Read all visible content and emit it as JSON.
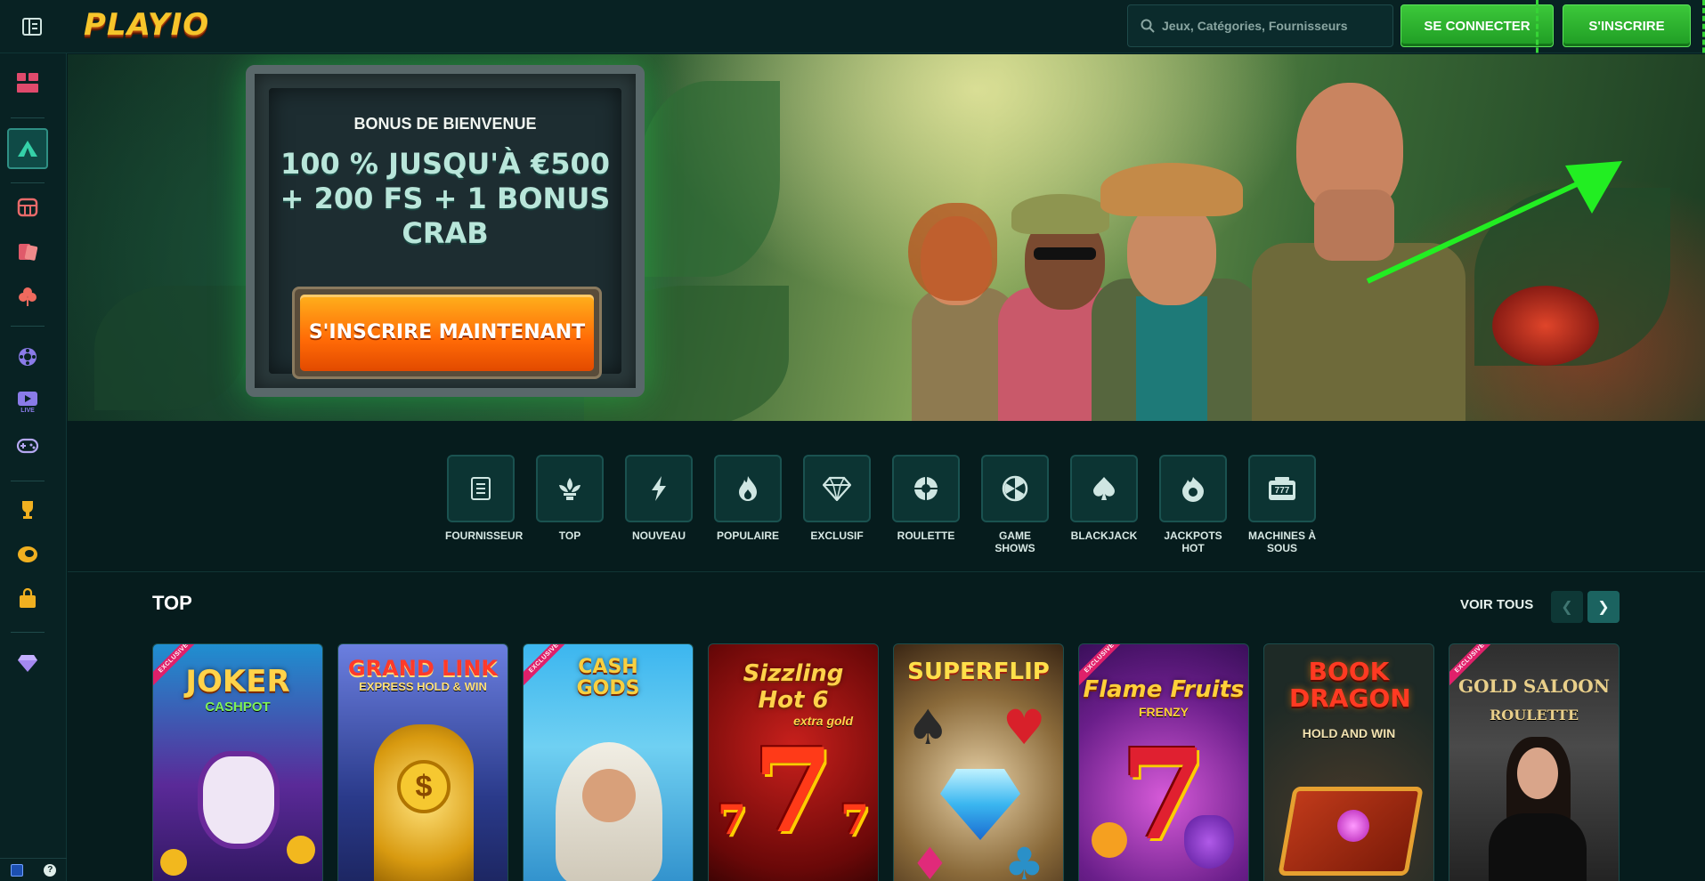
{
  "brand": {
    "name": "PLAYIO"
  },
  "header": {
    "search_placeholder": "Jeux, Catégories, Fournisseurs",
    "login_label": "SE CONNECTER",
    "signup_label": "S'INSCRIRE"
  },
  "sidebar": {
    "items": [
      {
        "icon": "lobby-icon"
      },
      {
        "icon": "camp-icon"
      },
      {
        "icon": "slot-machine-icon"
      },
      {
        "icon": "cards-icon"
      },
      {
        "icon": "clover-icon"
      },
      {
        "icon": "roulette-icon"
      },
      {
        "icon": "live-icon",
        "badge": "LIVE"
      },
      {
        "icon": "gamepad-icon"
      },
      {
        "icon": "trophy-icon"
      },
      {
        "icon": "promo-icon"
      },
      {
        "icon": "shop-icon"
      },
      {
        "icon": "vip-diamond-icon"
      }
    ]
  },
  "hero": {
    "kicker": "BONUS DE BIENVENUE",
    "title": "100 % JUSQU'À €500 + 200 FS + 1 BONUS CRAB",
    "cta": "S'INSCRIRE MAINTENANT"
  },
  "categories": [
    {
      "label": "FOURNISSEUR",
      "icon": "provider-icon"
    },
    {
      "label": "TOP",
      "icon": "fleur-icon"
    },
    {
      "label": "NOUVEAU",
      "icon": "lightning-icon"
    },
    {
      "label": "POPULAIRE",
      "icon": "flame-icon"
    },
    {
      "label": "EXCLUSIF",
      "icon": "diamond-icon"
    },
    {
      "label": "ROULETTE",
      "icon": "roulette-wheel-icon"
    },
    {
      "label": "GAME SHOWS",
      "icon": "wheel-icon"
    },
    {
      "label": "BLACKJACK",
      "icon": "spade-icon"
    },
    {
      "label": "JACKPOTS HOT",
      "icon": "hot-jackpot-icon"
    },
    {
      "label": "MACHINES À SOUS",
      "icon": "slot-777-icon"
    }
  ],
  "top_section": {
    "title": "TOP",
    "see_all": "VOIR TOUS"
  },
  "games": [
    {
      "name": "JOKER",
      "sub": "CASHPOT",
      "ribbon": "EXCLUSIVE"
    },
    {
      "name": "GRAND LINK",
      "sub": "EXPRESS HOLD & WIN",
      "ribbon": ""
    },
    {
      "name": "CASH GODS",
      "sub": "",
      "ribbon": "EXCLUSIVE"
    },
    {
      "name": "Sizzling Hot 6",
      "sub": "extra gold",
      "ribbon": ""
    },
    {
      "name": "SUPERFLIP",
      "sub": "",
      "ribbon": ""
    },
    {
      "name": "Flame Fruits",
      "sub": "FRENZY",
      "ribbon": "EXCLUSIVE"
    },
    {
      "name": "BOOK DRAGON",
      "sub": "HOLD AND WIN",
      "ribbon": ""
    },
    {
      "name": "GOLD SALOON",
      "sub": "ROULETTE",
      "ribbon": "EXCLUSIVE"
    }
  ],
  "colors": {
    "background": "#061c1d",
    "accent_green": "#2fb52f",
    "cta_orange": "#ff6a06",
    "teal_panel": "#0c3433"
  }
}
